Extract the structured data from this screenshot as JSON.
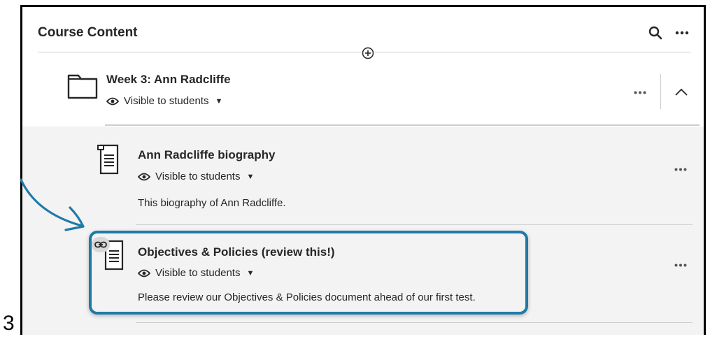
{
  "corner_label": "3",
  "header": {
    "title": "Course Content",
    "search_icon": "search-icon",
    "more_icon": "more-options-icon"
  },
  "folder": {
    "title": "Week 3: Ann Radcliffe",
    "visibility": "Visible to students",
    "icon": "folder-icon"
  },
  "items": [
    {
      "title": "Ann Radcliffe biography",
      "visibility": "Visible to students",
      "description": "This biography of Ann Radcliffe.",
      "icon": "document-icon"
    },
    {
      "title": "Objectives & Policies (review this!)",
      "visibility": "Visible to students",
      "description": "Please review our Objectives & Policies document ahead of our first test.",
      "icon": "document-icon",
      "badge_icon": "link-icon"
    }
  ],
  "colors": {
    "highlight": "#1f7aa8",
    "text": "#262626",
    "panel": "#f3f3f3"
  }
}
